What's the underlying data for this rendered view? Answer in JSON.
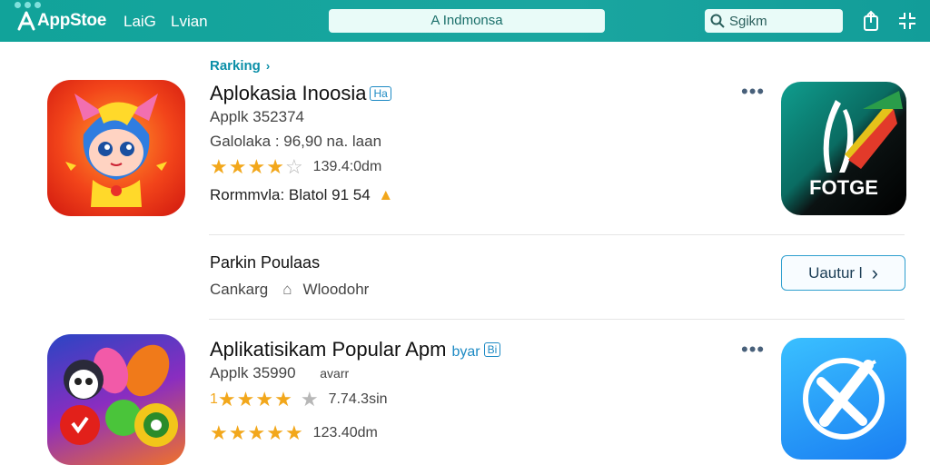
{
  "header": {
    "logo": "AppStoe",
    "nav": [
      "LaiG",
      "Lvian"
    ],
    "region": "A Indmonsa",
    "search_placeholder": "Sgikm",
    "icons": [
      "share-icon",
      "expand-icon"
    ]
  },
  "ranking": {
    "label": "Rarking",
    "chevron": "›"
  },
  "apps": [
    {
      "title": "Aplokasia Inoosia",
      "tag": "",
      "badge": "Ha",
      "sub": "Applk 352374",
      "detail": "Galolaka : 96,90 na. laan",
      "rating": 4.5,
      "rating_label": "139.4:0dm",
      "footer": "Rormmvla: Blatol 91 54",
      "side_icon_text": "FOTGE"
    },
    {
      "title": "Aplikatisikam Popular Apm",
      "tag": "byar",
      "badge": "Bi",
      "sub": "Applk 35990",
      "sub2": "avarr",
      "rating_a": 4,
      "rating_a_prefix": "1",
      "rating_a_label": "7.74.3sin",
      "rating_b": 5,
      "rating_b_label": "123.40dm"
    }
  ],
  "popular": {
    "title": "Parkin Poulaas",
    "sub_left": "Cankarg",
    "sub_right": "Wloodohr",
    "button": "Uautur l",
    "button_chev": "›"
  },
  "colors": {
    "topbar": "#13a39b",
    "accent": "#0b8fa8",
    "star": "#f2a71b"
  }
}
